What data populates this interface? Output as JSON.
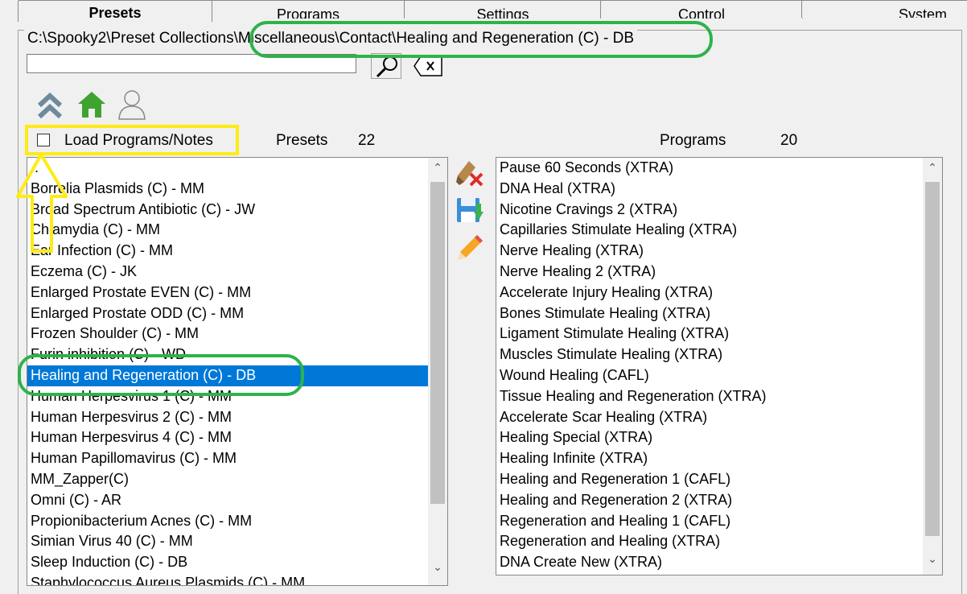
{
  "tabs": [
    {
      "label": "Presets",
      "active": true
    },
    {
      "label": "Programs",
      "active": false
    },
    {
      "label": "Settings",
      "active": false
    },
    {
      "label": "Control",
      "active": false
    },
    {
      "label": "System",
      "active": false
    }
  ],
  "path": "C:\\Spooky2\\Preset Collections\\Miscellaneous\\Contact\\Healing and Regeneration (C) - DB",
  "search": {
    "value": ""
  },
  "load_programs_label": "Load Programs/Notes",
  "presets": {
    "label": "Presets",
    "count": "22",
    "items": [
      "..",
      "Borrelia Plasmids (C) - MM",
      "Broad Spectrum Antibiotic (C) - JW",
      "Chlamydia (C) - MM",
      "Ear Infection (C) - MM",
      "Eczema (C) - JK",
      "Enlarged Prostate EVEN (C) - MM",
      "Enlarged Prostate ODD (C) - MM",
      "Frozen Shoulder (C) -  MM",
      "Furin inhibition (C) - WD",
      "Healing and Regeneration (C) - DB",
      "Human Herpesvirus 1 (C) - MM",
      "Human Herpesvirus 2 (C) - MM",
      "Human Herpesvirus 4 (C) - MM",
      "Human Papillomavirus (C) - MM",
      "MM_Zapper(C)",
      "Omni (C) - AR",
      "Propionibacterium Acnes (C) - MM",
      "Simian Virus 40 (C) - MM",
      "Sleep Induction (C) - DB",
      "Staphylococcus Aureus Plasmids (C) - MM"
    ],
    "selected": "Healing and Regeneration (C) - DB"
  },
  "programs": {
    "label": "Programs",
    "count": "20",
    "items": [
      "Pause 60 Seconds (XTRA)",
      "DNA Heal (XTRA)",
      "Nicotine Cravings 2 (XTRA)",
      "Capillaries Stimulate Healing (XTRA)",
      "Nerve Healing (XTRA)",
      "Nerve Healing 2 (XTRA)",
      "Accelerate Injury Healing (XTRA)",
      "Bones Stimulate Healing (XTRA)",
      "Ligament Stimulate Healing (XTRA)",
      "Muscles Stimulate Healing (XTRA)",
      "Wound Healing (CAFL)",
      "Tissue Healing and Regeneration (XTRA)",
      "Accelerate Scar Healing (XTRA)",
      "Healing Special (XTRA)",
      "Healing Infinite (XTRA)",
      "Healing and Regeneration 1 (CAFL)",
      "Healing and Regeneration 2 (XTRA)",
      "Regeneration and Healing 1 (CAFL)",
      "Regeneration and Healing (XTRA)",
      "DNA Create New (XTRA)"
    ]
  },
  "icons": {
    "search": "search-icon",
    "clear": "clear-search-icon",
    "up": "up-chevron-icon",
    "home": "home-icon",
    "user": "user-icon",
    "remove": "remove-program-icon",
    "save": "save-icon",
    "edit": "edit-pencil-icon"
  },
  "colors": {
    "selection": "#0078d7",
    "annotation_green": "#2db34a",
    "annotation_yellow": "#ffeb14"
  }
}
